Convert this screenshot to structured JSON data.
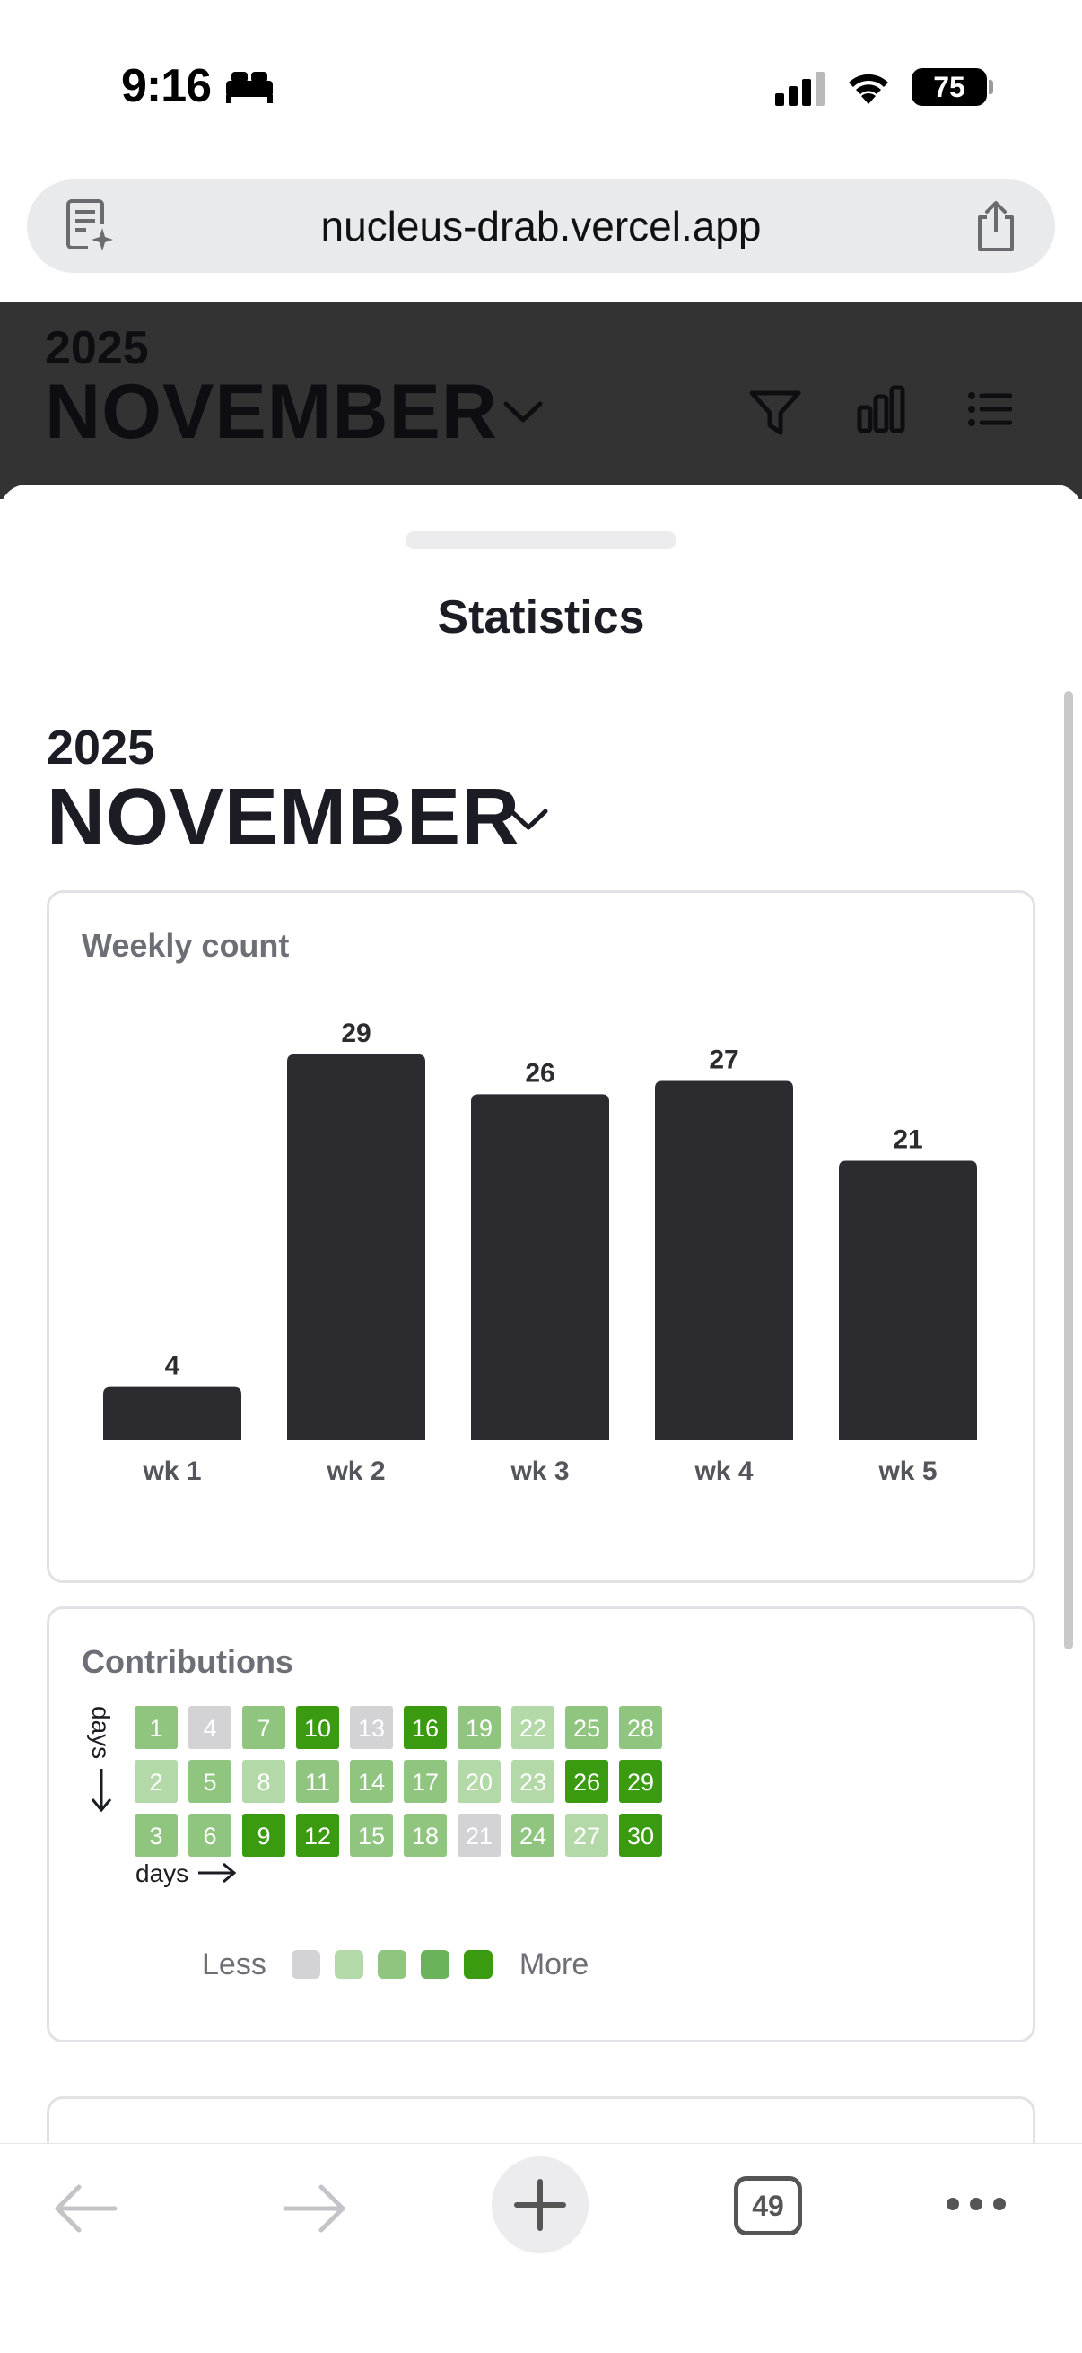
{
  "status_bar": {
    "time": "9:16",
    "battery": "75"
  },
  "browser": {
    "url": "nucleus-drab.vercel.app",
    "tabs_count": "49"
  },
  "app_header": {
    "year": "2025",
    "month": "NOVEMBER"
  },
  "sheet": {
    "title": "Statistics",
    "year": "2025",
    "month": "NOVEMBER"
  },
  "chart_card": {
    "title": "Weekly count"
  },
  "chart_data": {
    "type": "bar",
    "title": "Weekly count",
    "categories": [
      "wk 1",
      "wk 2",
      "wk 3",
      "wk 4",
      "wk 5"
    ],
    "values": [
      4,
      29,
      26,
      27,
      21
    ],
    "data_labels": true,
    "grid": false,
    "bar_color": "#2c2b30"
  },
  "contributions": {
    "title": "Contributions",
    "y_axis_label": "days",
    "x_axis_label": "days",
    "legend_less": "Less",
    "legend_more": "More",
    "legend_colors": [
      "#d3d3d6",
      "#b4d9a8",
      "#8fc57f",
      "#6ab35a",
      "#3a9a10"
    ],
    "days": [
      {
        "day": 1,
        "level": 2
      },
      {
        "day": 2,
        "level": 1
      },
      {
        "day": 3,
        "level": 2
      },
      {
        "day": 4,
        "level": 0
      },
      {
        "day": 5,
        "level": 2
      },
      {
        "day": 6,
        "level": 2
      },
      {
        "day": 7,
        "level": 2
      },
      {
        "day": 8,
        "level": 1
      },
      {
        "day": 9,
        "level": 4
      },
      {
        "day": 10,
        "level": 4
      },
      {
        "day": 11,
        "level": 2
      },
      {
        "day": 12,
        "level": 4
      },
      {
        "day": 13,
        "level": 0
      },
      {
        "day": 14,
        "level": 2
      },
      {
        "day": 15,
        "level": 2
      },
      {
        "day": 16,
        "level": 4
      },
      {
        "day": 17,
        "level": 2
      },
      {
        "day": 18,
        "level": 2
      },
      {
        "day": 19,
        "level": 2
      },
      {
        "day": 20,
        "level": 1
      },
      {
        "day": 21,
        "level": 0
      },
      {
        "day": 22,
        "level": 1
      },
      {
        "day": 23,
        "level": 1
      },
      {
        "day": 24,
        "level": 2
      },
      {
        "day": 25,
        "level": 2
      },
      {
        "day": 26,
        "level": 4
      },
      {
        "day": 27,
        "level": 1
      },
      {
        "day": 28,
        "level": 2
      },
      {
        "day": 29,
        "level": 4
      },
      {
        "day": 30,
        "level": 4
      }
    ]
  }
}
